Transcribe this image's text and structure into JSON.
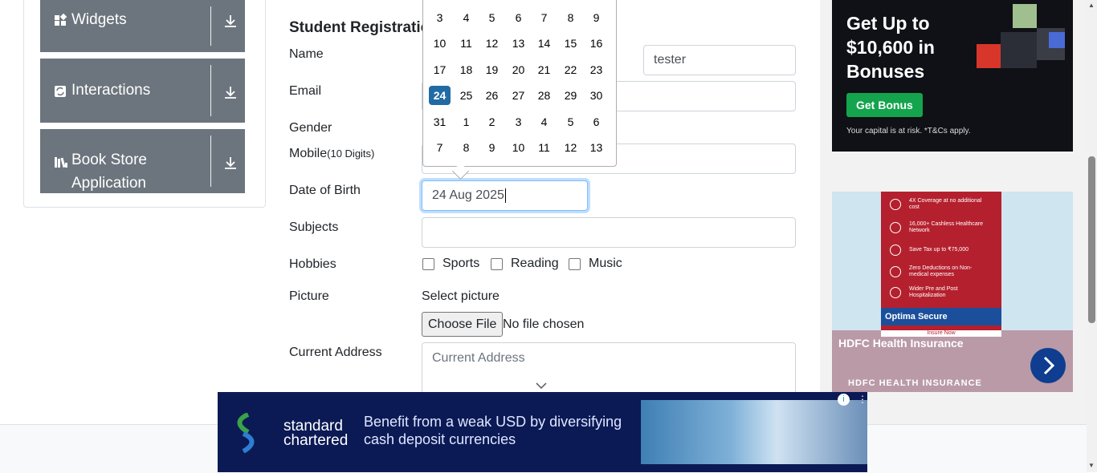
{
  "sidebar": {
    "groups": [
      {
        "label": "Widgets",
        "icon": "widgets-icon"
      },
      {
        "label": "Interactions",
        "icon": "interactions-icon"
      },
      {
        "label": "Book Store",
        "label2": "Application",
        "icon": "book-store-icon"
      }
    ]
  },
  "form": {
    "title": "Student Registration Form",
    "name_label": "Name",
    "last_name_value": "tester",
    "email_label": "Email",
    "gender_label": "Gender",
    "mobile_label": "Mobile",
    "mobile_hint": "(10 Digits)",
    "dob_label": "Date of Birth",
    "dob_value": "24 Aug 2025",
    "subjects_label": "Subjects",
    "hobbies_label": "Hobbies",
    "hobbies": [
      "Sports",
      "Reading",
      "Music"
    ],
    "picture_label": "Picture",
    "select_picture": "Select picture",
    "choose_file": "Choose File",
    "no_file": "No file chosen",
    "address_label": "Current Address",
    "address_placeholder": "Current Address"
  },
  "datepicker": {
    "weeks": [
      [
        "3",
        "4",
        "5",
        "6",
        "7",
        "8",
        "9"
      ],
      [
        "10",
        "11",
        "12",
        "13",
        "14",
        "15",
        "16"
      ],
      [
        "17",
        "18",
        "19",
        "20",
        "21",
        "22",
        "23"
      ],
      [
        "24",
        "25",
        "26",
        "27",
        "28",
        "29",
        "30"
      ],
      [
        "31",
        "1",
        "2",
        "3",
        "4",
        "5",
        "6"
      ],
      [
        "7",
        "8",
        "9",
        "10",
        "11",
        "12",
        "13"
      ]
    ],
    "selected": "24"
  },
  "ads": {
    "bonus_headline": "Get Up to $10,600 in Bonuses",
    "bonus_button": "Get Bonus",
    "bonus_disclaimer": "Your capital is at risk. *T&Cs apply.",
    "hdfc_features": [
      "4X Coverage at no additional cost",
      "16,000+ Cashless Healthcare Network",
      "Save Tax up to ₹75,000",
      "Zero Deductions on Non-medical expenses",
      "Wider Pre and Post Hospitalization"
    ],
    "hdfc_brand_bar": "Optima Secure",
    "hdfc_insure": "Insure Now",
    "hdfc_title": "HDFC Health Insurance",
    "hdfc_sub": "HDFC HEALTH INSURANCE",
    "sc_brand": "standard chartered",
    "sc_message": "Benefit from a weak USD by diversifying cash deposit currencies"
  }
}
